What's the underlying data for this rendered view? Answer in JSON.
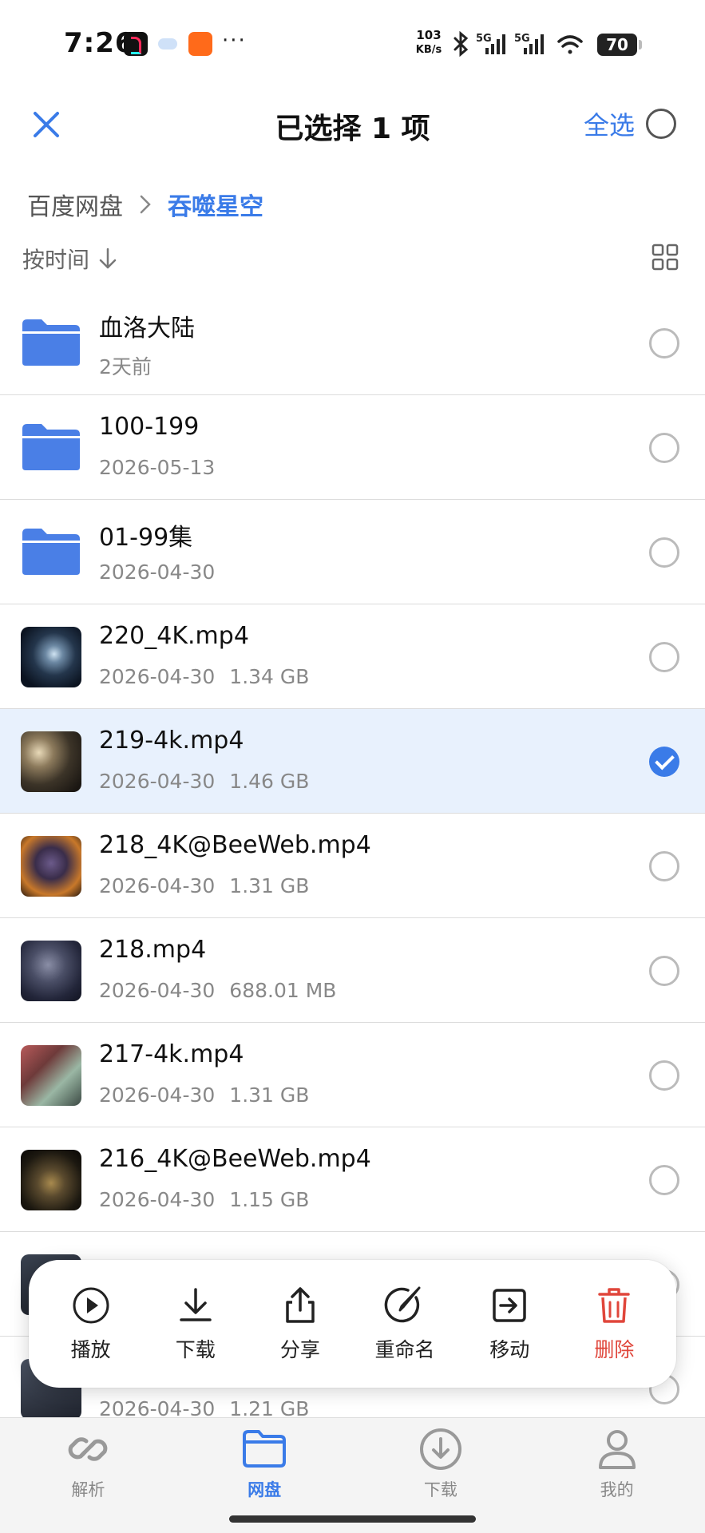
{
  "status_bar": {
    "time": "7:26",
    "net_speed_value": "103",
    "net_speed_unit": "KB/s",
    "network_1": "5G",
    "network_2": "5G",
    "battery": "70"
  },
  "header": {
    "title": "已选择 1 项",
    "select_all_label": "全选"
  },
  "breadcrumb": {
    "root": "百度网盘",
    "current": "吞噬星空"
  },
  "sort": {
    "label": "按时间"
  },
  "files": [
    {
      "name": "血洛大陆",
      "date": "2天前",
      "size": "",
      "type": "folder",
      "selected": false
    },
    {
      "name": "100-199",
      "date": "2026-05-13",
      "size": "",
      "type": "folder",
      "selected": false
    },
    {
      "name": "01-99集",
      "date": "2026-04-30",
      "size": "",
      "type": "folder",
      "selected": false
    },
    {
      "name": "220_4K.mp4",
      "date": "2026-04-30",
      "size": "1.34 GB",
      "type": "video",
      "selected": false
    },
    {
      "name": "219-4k.mp4",
      "date": "2026-04-30",
      "size": "1.46 GB",
      "type": "video",
      "selected": true
    },
    {
      "name": "218_4K@BeeWeb.mp4",
      "date": "2026-04-30",
      "size": "1.31 GB",
      "type": "video",
      "selected": false
    },
    {
      "name": "218.mp4",
      "date": "2026-04-30",
      "size": "688.01 MB",
      "type": "video",
      "selected": false
    },
    {
      "name": "217-4k.mp4",
      "date": "2026-04-30",
      "size": "1.31 GB",
      "type": "video",
      "selected": false
    },
    {
      "name": "216_4K@BeeWeb.mp4",
      "date": "2026-04-30",
      "size": "1.15 GB",
      "type": "video",
      "selected": false
    },
    {
      "name": "",
      "date": "",
      "size": "",
      "type": "video",
      "selected": false
    },
    {
      "name": "",
      "date": "2026-04-30",
      "size": "1.21 GB",
      "type": "video",
      "selected": false
    }
  ],
  "actions": {
    "play": "播放",
    "download": "下载",
    "share": "分享",
    "rename": "重命名",
    "move": "移动",
    "delete": "删除"
  },
  "nav": {
    "parse": "解析",
    "drive": "网盘",
    "download": "下载",
    "mine": "我的"
  },
  "colors": {
    "accent": "#3a7be8",
    "danger": "#e0463b",
    "selected_row": "#e8f1fd",
    "folder": "#4a7fe6"
  }
}
